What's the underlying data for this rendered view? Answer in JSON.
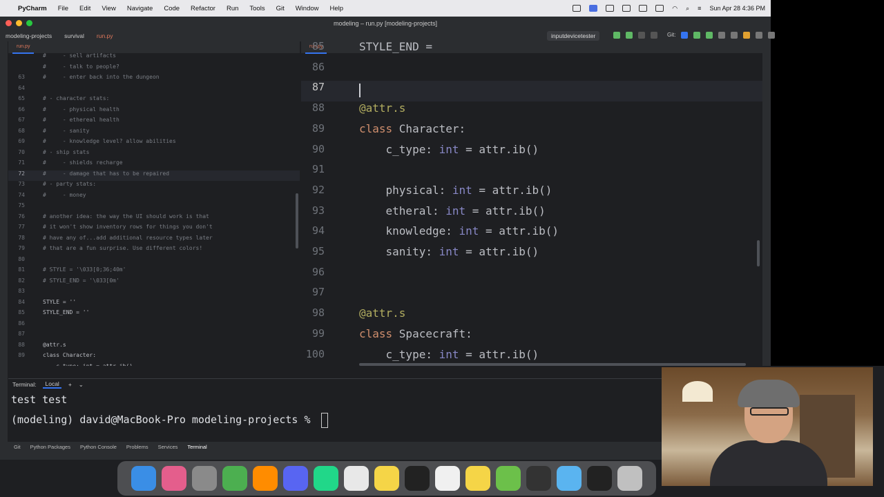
{
  "mac_menubar": {
    "app_name": "PyCharm",
    "menus": [
      "File",
      "Edit",
      "View",
      "Navigate",
      "Code",
      "Refactor",
      "Run",
      "Tools",
      "Git",
      "Window",
      "Help"
    ],
    "clock": "Sun Apr 28  4:36 PM"
  },
  "window": {
    "title": "modeling – run.py [modeling-projects]",
    "breadcrumbs": [
      "modeling-projects",
      "survival",
      "run.py"
    ],
    "run_config": "inputdevicetester",
    "git_label": "Git:"
  },
  "left_editor": {
    "tab": "run.py",
    "active_line": "72",
    "lines": [
      {
        "n": "",
        "t": "#     - sell artifacts",
        "c": true
      },
      {
        "n": "",
        "t": "#     - talk to people?",
        "c": true
      },
      {
        "n": "63",
        "t": "#     - enter back into the dungeon",
        "c": true
      },
      {
        "n": "64",
        "t": "",
        "c": false
      },
      {
        "n": "65",
        "t": "# - character stats:",
        "c": true
      },
      {
        "n": "66",
        "t": "#     - physical health",
        "c": true
      },
      {
        "n": "67",
        "t": "#     - ethereal health",
        "c": true
      },
      {
        "n": "68",
        "t": "#     - sanity",
        "c": true
      },
      {
        "n": "69",
        "t": "#     - knowledge level? allow abilities",
        "c": true
      },
      {
        "n": "70",
        "t": "# - ship stats",
        "c": true
      },
      {
        "n": "71",
        "t": "#     - shields recharge",
        "c": true
      },
      {
        "n": "72",
        "t": "#     - damage that has to be repaired",
        "c": true
      },
      {
        "n": "73",
        "t": "# - party stats:",
        "c": true
      },
      {
        "n": "74",
        "t": "#     - money",
        "c": true
      },
      {
        "n": "75",
        "t": "",
        "c": false
      },
      {
        "n": "76",
        "t": "# another idea: the way the UI should work is that",
        "c": true
      },
      {
        "n": "77",
        "t": "# it won't show inventory rows for things you don't",
        "c": true
      },
      {
        "n": "78",
        "t": "# have any of...add additional resource types later",
        "c": true
      },
      {
        "n": "79",
        "t": "# that are a fun surprise. Use different colors!",
        "c": true
      },
      {
        "n": "80",
        "t": "",
        "c": false
      },
      {
        "n": "81",
        "t": "# STYLE = '\\033[0;36;40m'",
        "c": true
      },
      {
        "n": "82",
        "t": "# STYLE_END = '\\033[0m'",
        "c": true
      },
      {
        "n": "83",
        "t": "",
        "c": false
      },
      {
        "n": "84",
        "t": "STYLE = ''",
        "c": false
      },
      {
        "n": "85",
        "t": "STYLE_END = ''",
        "c": false
      },
      {
        "n": "86",
        "t": "",
        "c": false
      },
      {
        "n": "87",
        "t": "",
        "c": false
      },
      {
        "n": "88",
        "t": "@attr.s",
        "c": false
      },
      {
        "n": "89",
        "t": "class Character:",
        "c": false
      },
      {
        "n": "",
        "t": "    c_type: int = attr.ib()",
        "c": false
      }
    ]
  },
  "right_editor": {
    "tab": "run.py",
    "lines": [
      {
        "n": "85",
        "parts": [
          {
            "t": "STYLE_END = ",
            "k": ""
          }
        ]
      },
      {
        "n": "86",
        "parts": []
      },
      {
        "n": "87",
        "parts": []
      },
      {
        "n": "88",
        "parts": [
          {
            "t": "@attr.s",
            "k": "dec"
          }
        ]
      },
      {
        "n": "89",
        "parts": [
          {
            "t": "class ",
            "k": "kw"
          },
          {
            "t": "Character:",
            "k": ""
          }
        ]
      },
      {
        "n": "90",
        "parts": [
          {
            "t": "    c_type: ",
            "k": ""
          },
          {
            "t": "int",
            "k": "ty"
          },
          {
            "t": " = attr.ib()",
            "k": ""
          }
        ]
      },
      {
        "n": "91",
        "parts": []
      },
      {
        "n": "92",
        "parts": [
          {
            "t": "    physical: ",
            "k": ""
          },
          {
            "t": "int",
            "k": "ty"
          },
          {
            "t": " = attr.ib()",
            "k": ""
          }
        ]
      },
      {
        "n": "93",
        "parts": [
          {
            "t": "    etheral: ",
            "k": ""
          },
          {
            "t": "int",
            "k": "ty"
          },
          {
            "t": " = attr.ib()",
            "k": ""
          }
        ]
      },
      {
        "n": "94",
        "parts": [
          {
            "t": "    knowledge: ",
            "k": ""
          },
          {
            "t": "int",
            "k": "ty"
          },
          {
            "t": " = attr.ib()",
            "k": ""
          }
        ]
      },
      {
        "n": "95",
        "parts": [
          {
            "t": "    sanity: ",
            "k": ""
          },
          {
            "t": "int",
            "k": "ty"
          },
          {
            "t": " = attr.ib()",
            "k": ""
          }
        ]
      },
      {
        "n": "96",
        "parts": []
      },
      {
        "n": "97",
        "parts": []
      },
      {
        "n": "98",
        "parts": [
          {
            "t": "@attr.s",
            "k": "dec"
          }
        ]
      },
      {
        "n": "99",
        "parts": [
          {
            "t": "class ",
            "k": "kw"
          },
          {
            "t": "Spacecraft:",
            "k": ""
          }
        ]
      },
      {
        "n": "100",
        "parts": [
          {
            "t": "    c_type: ",
            "k": ""
          },
          {
            "t": "int",
            "k": "ty"
          },
          {
            "t": " = attr.ib()",
            "k": ""
          }
        ]
      }
    ],
    "active_line": "87"
  },
  "terminal": {
    "label": "Terminal:",
    "tab": "Local",
    "lines": [
      "test test",
      "(modeling) david@MacBook-Pro modeling-projects % "
    ]
  },
  "bottom_tools": [
    "Git",
    "Python Packages",
    "Python Console",
    "Problems",
    "Services",
    "Terminal"
  ],
  "dock_apps": [
    "finder-icon",
    "launchpad-icon",
    "system-settings-icon",
    "sync-icon",
    "vlc-icon",
    "discord-icon",
    "pycharm-icon",
    "chrome-icon",
    "notes-icon",
    "terminal-icon",
    "document-icon",
    "notes2-icon",
    "app-icon",
    "obs-icon",
    "folder-icon",
    "screen-icon",
    "trash-icon"
  ],
  "colors": {
    "accent": "#3574f0",
    "keyword": "#cf8e6d",
    "decorator": "#b3ae60",
    "type": "#8888c6"
  }
}
